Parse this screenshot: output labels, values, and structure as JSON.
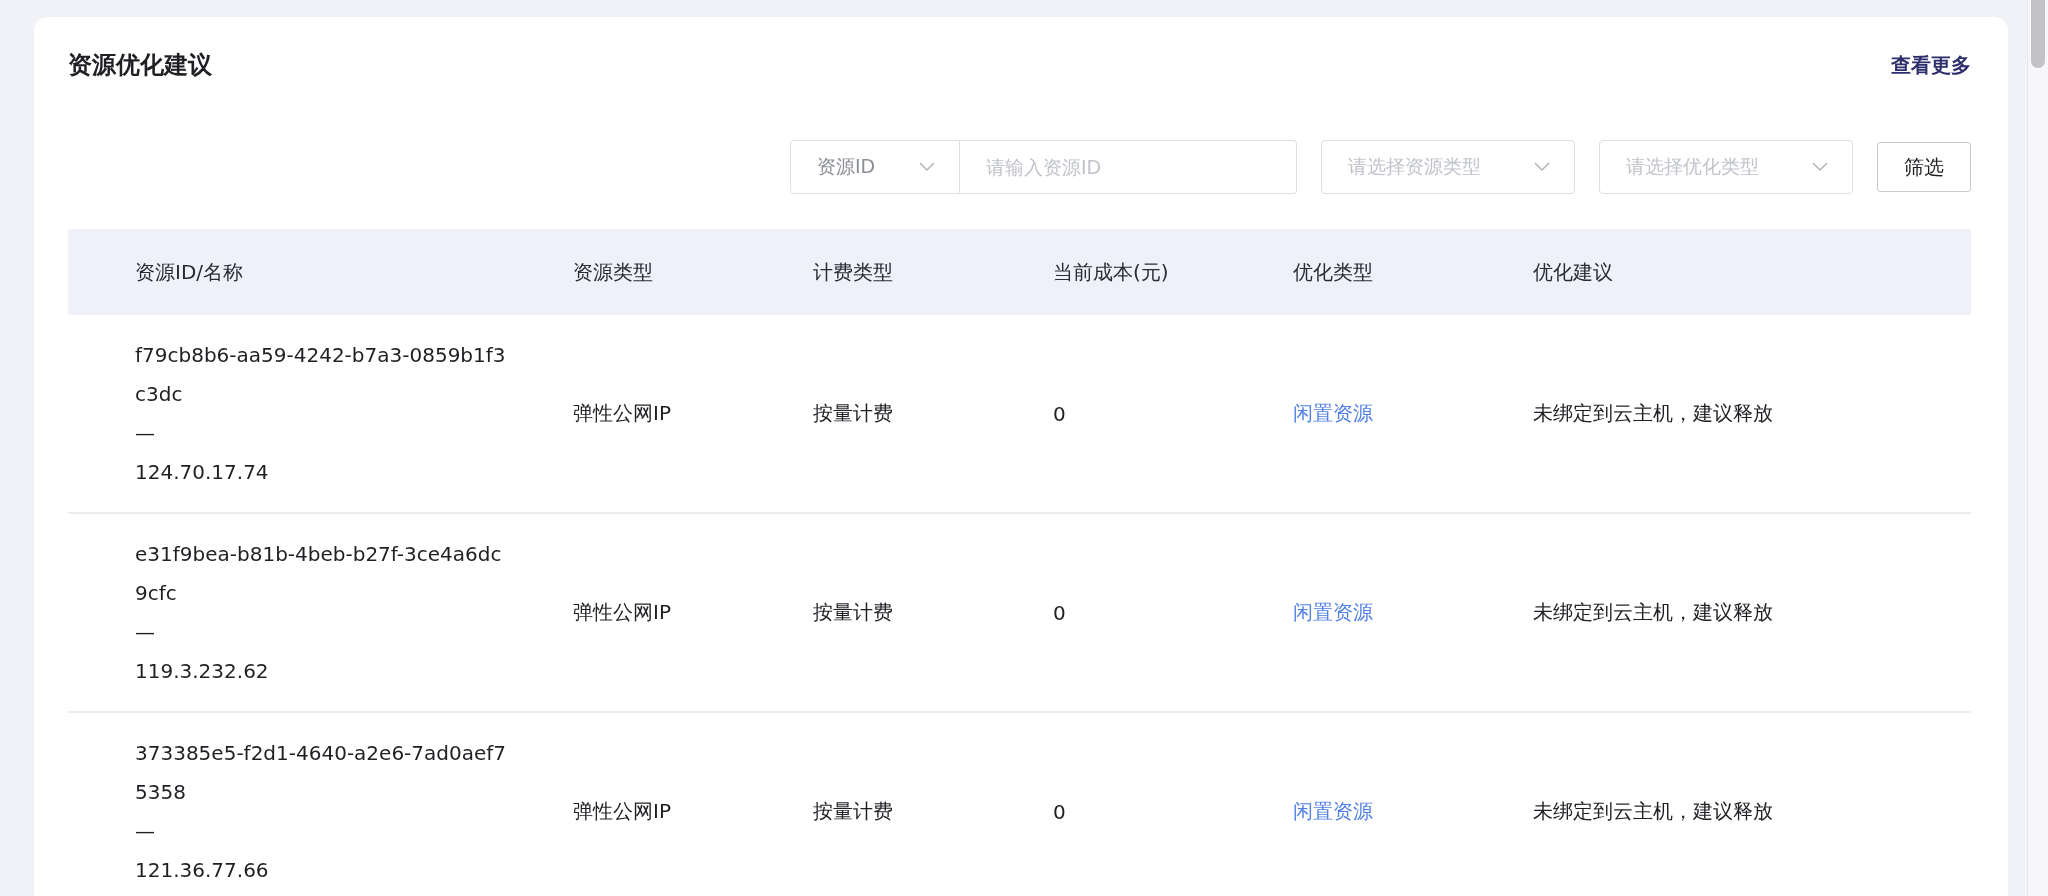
{
  "card": {
    "title": "资源优化建议",
    "more_link": "查看更多"
  },
  "filters": {
    "id_select": "资源ID",
    "id_input": {
      "placeholder": "请输入资源ID"
    },
    "resource_type": {
      "placeholder": "请选择资源类型"
    },
    "optimize_type": {
      "placeholder": "请选择优化类型"
    },
    "button": "筛选"
  },
  "table": {
    "columns": [
      "资源ID/名称",
      "资源类型",
      "计费类型",
      "当前成本(元)",
      "优化类型",
      "优化建议"
    ],
    "rows": [
      {
        "id": "f79cb8b6-aa59-4242-b7a3-0859b1f3c3dc",
        "separator": "—",
        "ip": "124.70.17.74",
        "resource_type": "弹性公网IP",
        "billing": "按量计费",
        "cost": "0",
        "optimize_type": "闲置资源",
        "advice": "未绑定到云主机，建议释放"
      },
      {
        "id": "e31f9bea-b81b-4beb-b27f-3ce4a6dc9cfc",
        "separator": "—",
        "ip": "119.3.232.62",
        "resource_type": "弹性公网IP",
        "billing": "按量计费",
        "cost": "0",
        "optimize_type": "闲置资源",
        "advice": "未绑定到云主机，建议释放"
      },
      {
        "id": "373385e5-f2d1-4640-a2e6-7ad0aef75358",
        "separator": "—",
        "ip": "121.36.77.66",
        "resource_type": "弹性公网IP",
        "billing": "按量计费",
        "cost": "0",
        "optimize_type": "闲置资源",
        "advice": "未绑定到云主机，建议释放"
      }
    ]
  }
}
